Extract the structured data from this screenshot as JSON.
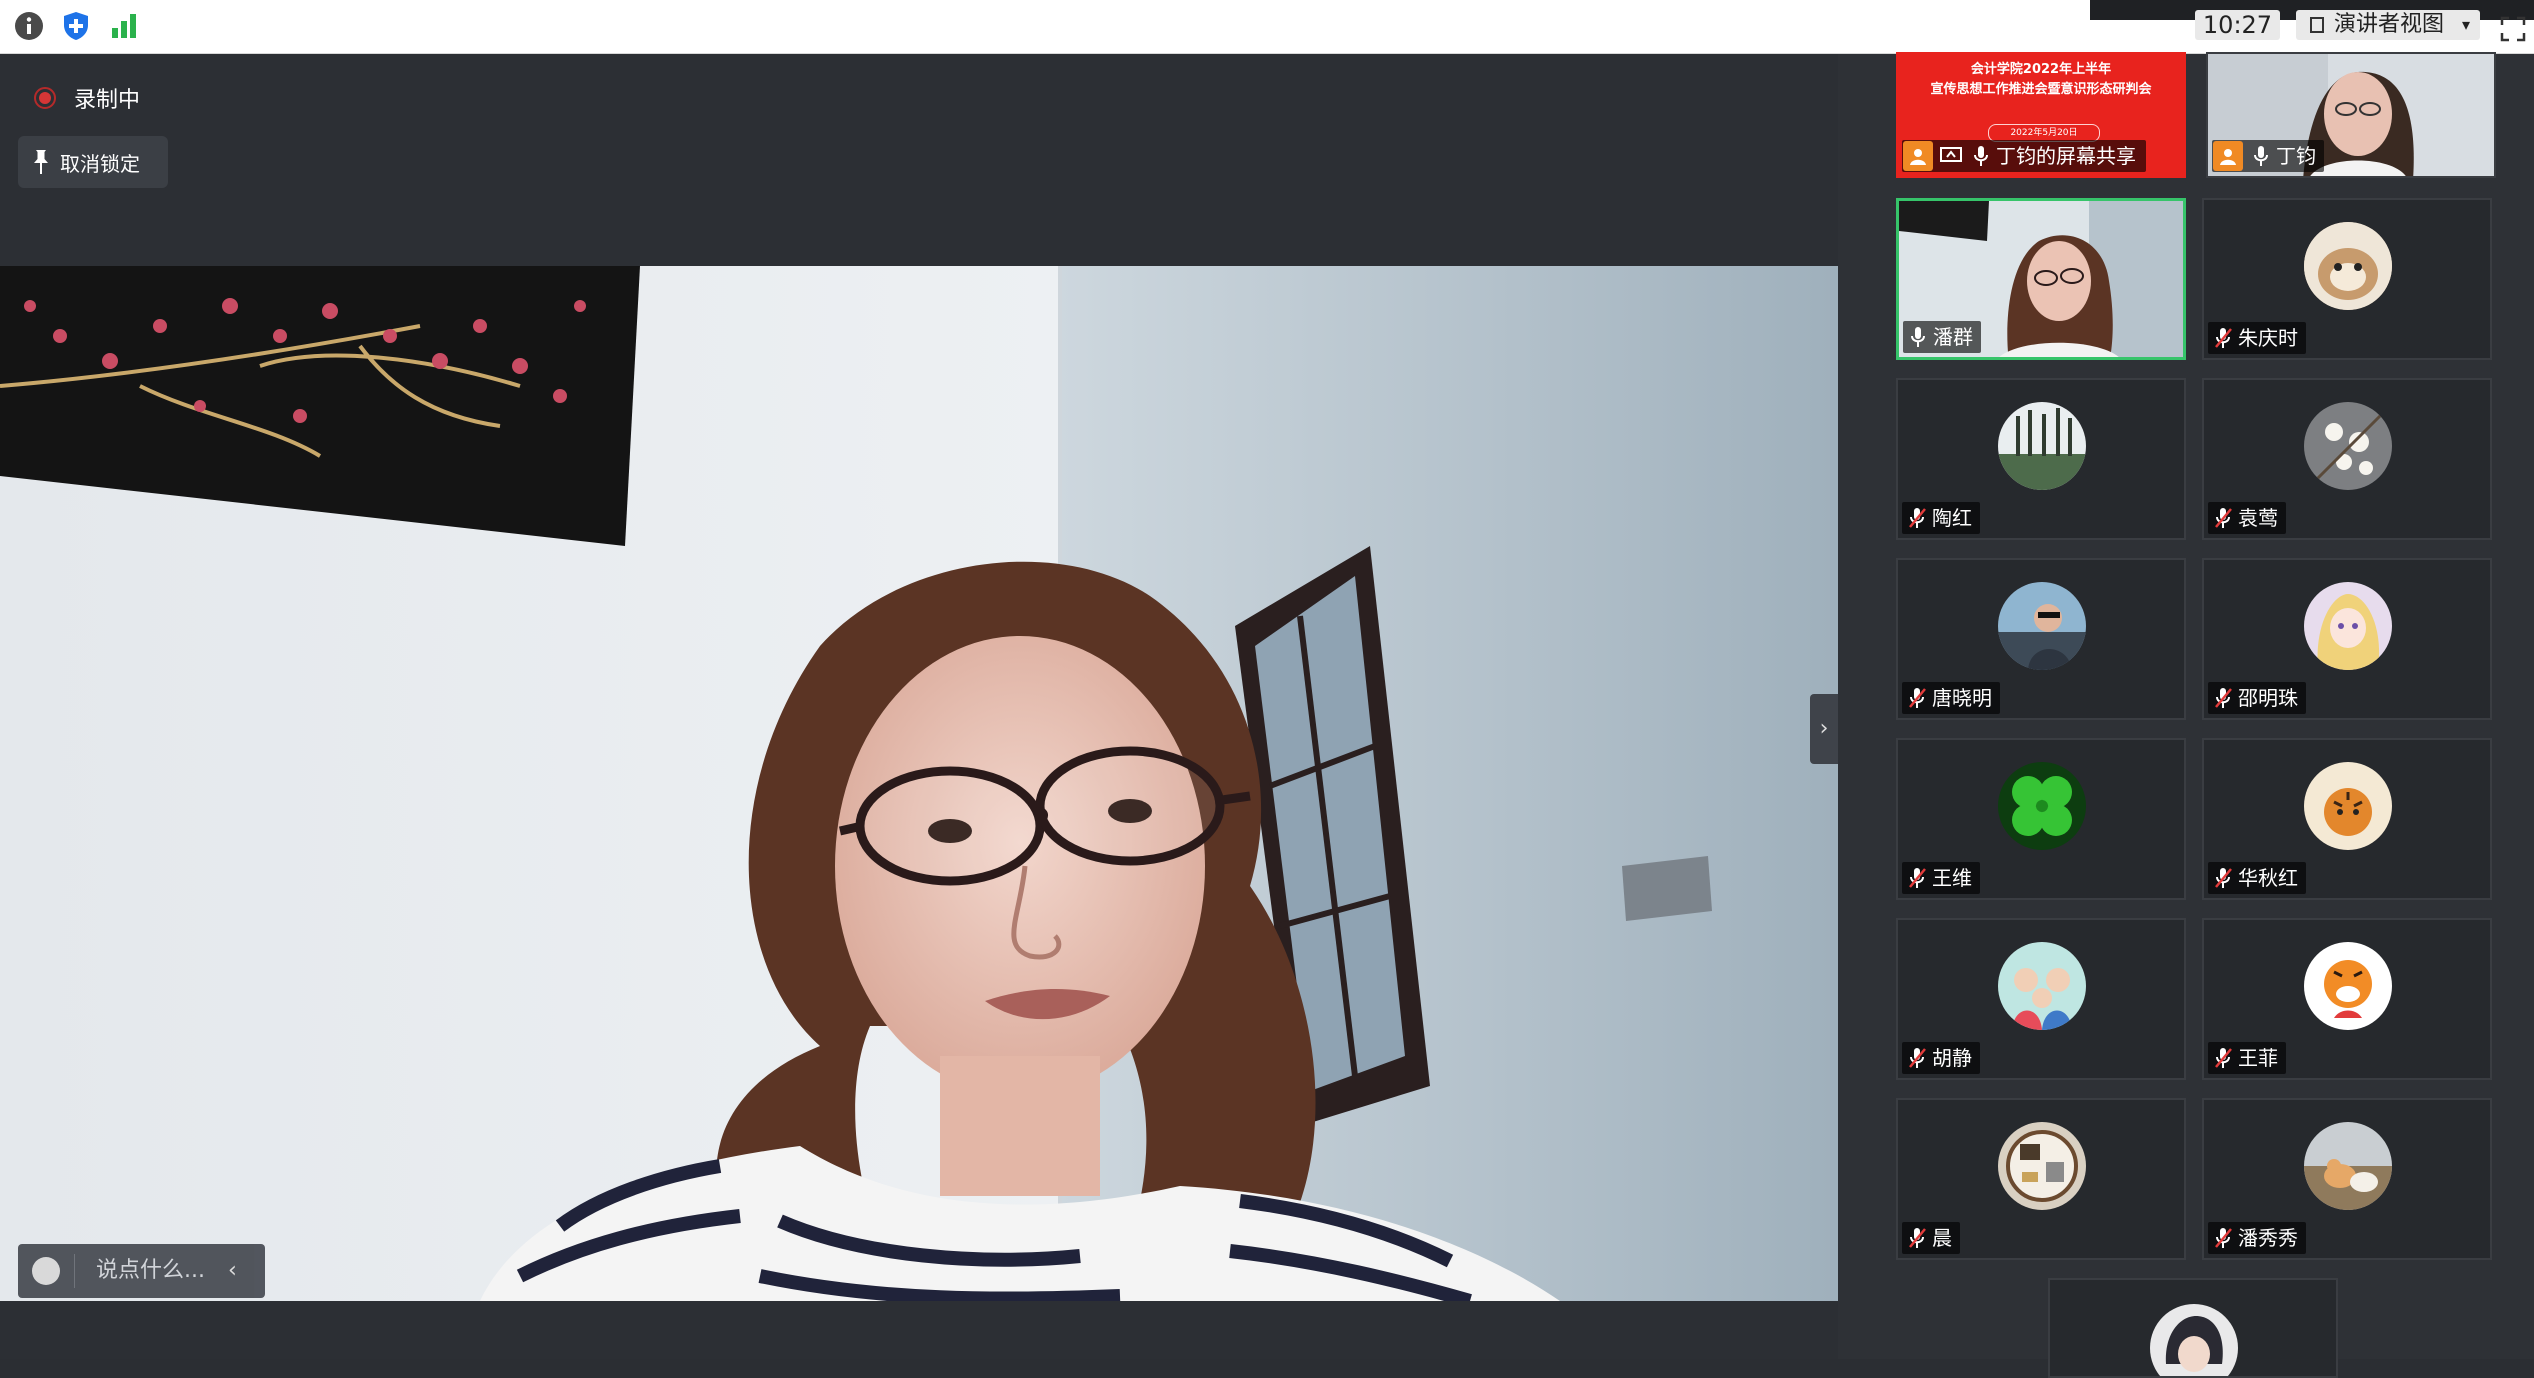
{
  "toolbar": {
    "time": "10:27",
    "view_label": "演讲者视图"
  },
  "main": {
    "recording_label": "录制中",
    "unpin_label": "取消锁定",
    "chat_placeholder": "说点什么..."
  },
  "screen_share": {
    "title_line1": "会计学院2022年上半年",
    "title_line2": "宣传思想工作推进会暨意识形态研判会",
    "date": "2022年5月20日",
    "label": "丁钧的屏幕共享"
  },
  "participants": [
    {
      "name": "丁钧",
      "muted": false
    },
    {
      "name": "潘群",
      "muted": false,
      "speaking": true
    },
    {
      "name": "朱庆时",
      "muted": true
    },
    {
      "name": "陶红",
      "muted": true
    },
    {
      "name": "袁莺",
      "muted": true
    },
    {
      "name": "唐晓明",
      "muted": true
    },
    {
      "name": "邵明珠",
      "muted": true
    },
    {
      "name": "王维",
      "muted": true
    },
    {
      "name": "华秋红",
      "muted": true
    },
    {
      "name": "胡静",
      "muted": true
    },
    {
      "name": "王菲",
      "muted": true
    },
    {
      "name": "晨",
      "muted": true
    },
    {
      "name": "潘秀秀",
      "muted": true
    }
  ],
  "colors": {
    "accent_green": "#36c46a",
    "share_red": "#e8231e",
    "host_orange": "#f08a24",
    "recording_red": "#d63636"
  }
}
